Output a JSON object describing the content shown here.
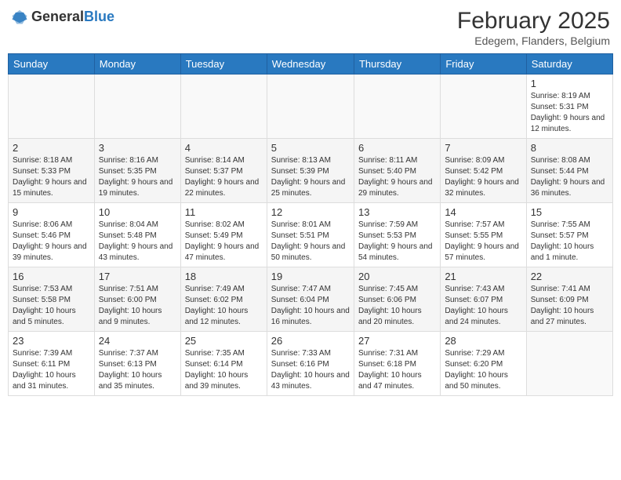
{
  "header": {
    "logo_general": "General",
    "logo_blue": "Blue",
    "month_year": "February 2025",
    "location": "Edegem, Flanders, Belgium"
  },
  "weekdays": [
    "Sunday",
    "Monday",
    "Tuesday",
    "Wednesday",
    "Thursday",
    "Friday",
    "Saturday"
  ],
  "weeks": [
    [
      {
        "day": "",
        "info": ""
      },
      {
        "day": "",
        "info": ""
      },
      {
        "day": "",
        "info": ""
      },
      {
        "day": "",
        "info": ""
      },
      {
        "day": "",
        "info": ""
      },
      {
        "day": "",
        "info": ""
      },
      {
        "day": "1",
        "info": "Sunrise: 8:19 AM\nSunset: 5:31 PM\nDaylight: 9 hours and 12 minutes."
      }
    ],
    [
      {
        "day": "2",
        "info": "Sunrise: 8:18 AM\nSunset: 5:33 PM\nDaylight: 9 hours and 15 minutes."
      },
      {
        "day": "3",
        "info": "Sunrise: 8:16 AM\nSunset: 5:35 PM\nDaylight: 9 hours and 19 minutes."
      },
      {
        "day": "4",
        "info": "Sunrise: 8:14 AM\nSunset: 5:37 PM\nDaylight: 9 hours and 22 minutes."
      },
      {
        "day": "5",
        "info": "Sunrise: 8:13 AM\nSunset: 5:39 PM\nDaylight: 9 hours and 25 minutes."
      },
      {
        "day": "6",
        "info": "Sunrise: 8:11 AM\nSunset: 5:40 PM\nDaylight: 9 hours and 29 minutes."
      },
      {
        "day": "7",
        "info": "Sunrise: 8:09 AM\nSunset: 5:42 PM\nDaylight: 9 hours and 32 minutes."
      },
      {
        "day": "8",
        "info": "Sunrise: 8:08 AM\nSunset: 5:44 PM\nDaylight: 9 hours and 36 minutes."
      }
    ],
    [
      {
        "day": "9",
        "info": "Sunrise: 8:06 AM\nSunset: 5:46 PM\nDaylight: 9 hours and 39 minutes."
      },
      {
        "day": "10",
        "info": "Sunrise: 8:04 AM\nSunset: 5:48 PM\nDaylight: 9 hours and 43 minutes."
      },
      {
        "day": "11",
        "info": "Sunrise: 8:02 AM\nSunset: 5:49 PM\nDaylight: 9 hours and 47 minutes."
      },
      {
        "day": "12",
        "info": "Sunrise: 8:01 AM\nSunset: 5:51 PM\nDaylight: 9 hours and 50 minutes."
      },
      {
        "day": "13",
        "info": "Sunrise: 7:59 AM\nSunset: 5:53 PM\nDaylight: 9 hours and 54 minutes."
      },
      {
        "day": "14",
        "info": "Sunrise: 7:57 AM\nSunset: 5:55 PM\nDaylight: 9 hours and 57 minutes."
      },
      {
        "day": "15",
        "info": "Sunrise: 7:55 AM\nSunset: 5:57 PM\nDaylight: 10 hours and 1 minute."
      }
    ],
    [
      {
        "day": "16",
        "info": "Sunrise: 7:53 AM\nSunset: 5:58 PM\nDaylight: 10 hours and 5 minutes."
      },
      {
        "day": "17",
        "info": "Sunrise: 7:51 AM\nSunset: 6:00 PM\nDaylight: 10 hours and 9 minutes."
      },
      {
        "day": "18",
        "info": "Sunrise: 7:49 AM\nSunset: 6:02 PM\nDaylight: 10 hours and 12 minutes."
      },
      {
        "day": "19",
        "info": "Sunrise: 7:47 AM\nSunset: 6:04 PM\nDaylight: 10 hours and 16 minutes."
      },
      {
        "day": "20",
        "info": "Sunrise: 7:45 AM\nSunset: 6:06 PM\nDaylight: 10 hours and 20 minutes."
      },
      {
        "day": "21",
        "info": "Sunrise: 7:43 AM\nSunset: 6:07 PM\nDaylight: 10 hours and 24 minutes."
      },
      {
        "day": "22",
        "info": "Sunrise: 7:41 AM\nSunset: 6:09 PM\nDaylight: 10 hours and 27 minutes."
      }
    ],
    [
      {
        "day": "23",
        "info": "Sunrise: 7:39 AM\nSunset: 6:11 PM\nDaylight: 10 hours and 31 minutes."
      },
      {
        "day": "24",
        "info": "Sunrise: 7:37 AM\nSunset: 6:13 PM\nDaylight: 10 hours and 35 minutes."
      },
      {
        "day": "25",
        "info": "Sunrise: 7:35 AM\nSunset: 6:14 PM\nDaylight: 10 hours and 39 minutes."
      },
      {
        "day": "26",
        "info": "Sunrise: 7:33 AM\nSunset: 6:16 PM\nDaylight: 10 hours and 43 minutes."
      },
      {
        "day": "27",
        "info": "Sunrise: 7:31 AM\nSunset: 6:18 PM\nDaylight: 10 hours and 47 minutes."
      },
      {
        "day": "28",
        "info": "Sunrise: 7:29 AM\nSunset: 6:20 PM\nDaylight: 10 hours and 50 minutes."
      },
      {
        "day": "",
        "info": ""
      }
    ]
  ]
}
